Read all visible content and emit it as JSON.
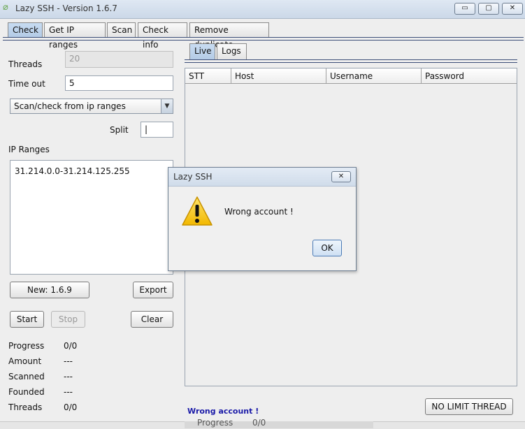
{
  "window": {
    "title": "Lazy SSH - Version 1.6.7",
    "minimize": "▭",
    "maximize": "▢",
    "close": "✕"
  },
  "main_tabs": [
    "Check",
    "Get IP ranges",
    "Scan",
    "Check info",
    "Remove duplicate"
  ],
  "form": {
    "threads_label": "Threads",
    "threads_value": "20",
    "timeout_label": "Time out",
    "timeout_value": "5",
    "mode_selected": "Scan/check from ip ranges",
    "split_label": "Split",
    "split_value": "|",
    "ipranges_label": "IP Ranges",
    "ipranges_value": "31.214.0.0-31.214.125.255"
  },
  "buttons": {
    "new": "New: 1.6.9",
    "export": "Export",
    "start": "Start",
    "stop": "Stop",
    "clear": "Clear",
    "no_limit": "NO LIMIT THREAD"
  },
  "stats": {
    "progress_label": "Progress",
    "progress_value": "0/0",
    "amount_label": "Amount",
    "amount_value": "---",
    "scanned_label": "Scanned",
    "scanned_value": "---",
    "founded_label": "Founded",
    "founded_value": "---",
    "threads_label": "Threads",
    "threads_value": "0/0",
    "progress_label_2": "Progress",
    "progress_value_2": "0/0"
  },
  "sub_tabs": [
    "Live",
    "Logs"
  ],
  "table": {
    "columns": [
      "STT",
      "Host",
      "Username",
      "Password"
    ]
  },
  "status_text": "Wrong account !",
  "dialog": {
    "title": "Lazy SSH",
    "message": "Wrong account !",
    "ok": "OK",
    "close": "✕",
    "icon": "warning-icon"
  }
}
